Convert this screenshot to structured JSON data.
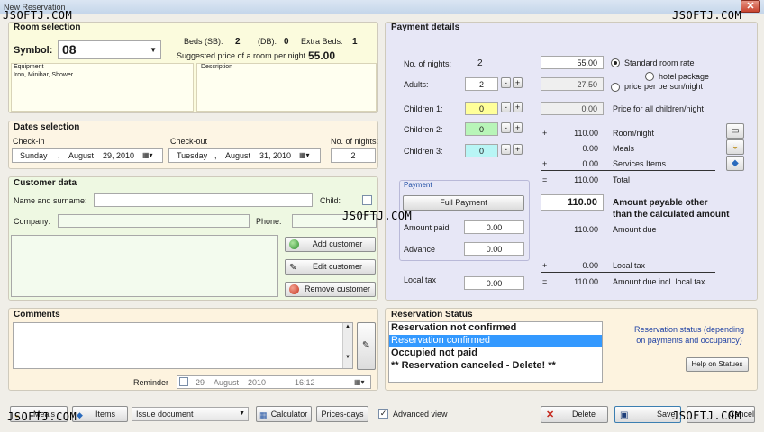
{
  "window": {
    "title": "New Reservation"
  },
  "watermarks": {
    "top_left": "JSOFTJ.COM",
    "top_right": "JSOFTJ.COM",
    "center": "JSOFTJ.COM",
    "bottom_left": "JSOFTJ.COM",
    "bottom_right": "JSOFTJ.COM"
  },
  "room": {
    "title": "Room selection",
    "symbol_label": "Symbol:",
    "symbol_value": "08",
    "beds_sb_label": "Beds (SB):",
    "beds_sb_value": "2",
    "beds_db_label": "(DB):",
    "beds_db_value": "0",
    "extra_beds_label": "Extra Beds:",
    "extra_beds_value": "1",
    "suggested_label": "Suggested price of a room per night",
    "suggested_value": "55.00",
    "equipment_label": "Equipment",
    "equipment_value": "Iron, Minibar, Shower",
    "description_label": "Description"
  },
  "dates": {
    "title": "Dates selection",
    "checkin_label": "Check-in",
    "checkin": {
      "weekday": "Sunday",
      "sep": ",",
      "month": "August",
      "day_year": "29, 2010"
    },
    "checkout_label": "Check-out",
    "checkout": {
      "weekday": "Tuesday",
      "sep": ",",
      "month": "August",
      "day_year": "31, 2010"
    },
    "nights_label": "No. of nights:",
    "nights_value": "2"
  },
  "customer": {
    "title": "Customer data",
    "name_label": "Name and surname:",
    "child_label": "Child:",
    "company_label": "Company:",
    "phone_label": "Phone:",
    "add_label": "Add customer",
    "edit_label": "Edit customer",
    "remove_label": "Remove customer"
  },
  "payment": {
    "title": "Payment details",
    "nights_label": "No. of nights:",
    "nights_value": "2",
    "adults_label": "Adults:",
    "adults_value": "2",
    "children1_label": "Children 1:",
    "children1_value": "0",
    "children2_label": "Children 2:",
    "children2_value": "0",
    "children3_label": "Children 3:",
    "children3_value": "0",
    "rate_value": "55.00",
    "per_person_value": "27.50",
    "children_value": "0.00",
    "standard_rate_label": "Standard room rate",
    "hotel_package_label": "hotel package",
    "per_person_label": "price per person/night",
    "children_price_label": "Price for all children/night",
    "room_night_sign": "+",
    "room_night_value": "110.00",
    "room_night_label": "Room/night",
    "meals_value": "0.00",
    "meals_label": "Meals",
    "services_sign": "+",
    "services_value": "0.00",
    "services_label": "Services Items",
    "total_sign": "=",
    "total_value": "110.00",
    "total_label": "Total",
    "payable_value": "110.00",
    "payable_label_1": "Amount payable other",
    "payable_label_2": "than the calculated amount",
    "amount_due_value": "110.00",
    "amount_due_label": "Amount due",
    "local_tax_sign": "+",
    "local_tax_value": "0.00",
    "local_tax_right_label": "Local tax",
    "due_incl_sign": "=",
    "due_incl_value": "110.00",
    "due_incl_label": "Amount due incl. local tax",
    "sub_title": "Payment",
    "full_payment_label": "Full Payment",
    "amount_paid_label": "Amount paid",
    "amount_paid_value": "0.00",
    "advance_label": "Advance",
    "advance_value": "0.00",
    "local_tax_label": "Local tax",
    "local_tax_field_value": "0.00"
  },
  "comments": {
    "title": "Comments",
    "reminder_label": "Reminder",
    "reminder_day": "29",
    "reminder_month": "August",
    "reminder_year": "2010",
    "reminder_time": "16:12"
  },
  "status": {
    "title": "Reservation Status",
    "items": [
      "Reservation not confirmed",
      "Reservation confirmed",
      "Occupied not paid",
      "** Reservation canceled - Delete! **"
    ],
    "selected_index": 1,
    "note": "Reservation status (depending on payments and occupancy)",
    "help_label": "Help on Statues"
  },
  "toolbar": {
    "meals_label": "Meals",
    "items_label": "Items",
    "issue_label": "Issue document",
    "calculator_label": "Calculator",
    "prices_label": "Prices-days",
    "advanced_label": "Advanced view",
    "advanced_checked": true,
    "delete_label": "Delete",
    "save_label": "Save",
    "cancel_label": "Cancel"
  },
  "colors": {
    "room_bg": "#fbfbdd",
    "dates_bg": "#fdf5e4",
    "customer_bg": "#eef8e2",
    "comments_bg": "#fdf3df",
    "payment_bg": "#e7e7f6",
    "status_bg": "#fdf3df",
    "child1": "#ffff99",
    "child2": "#b8f5b8",
    "child3": "#b8f5f5"
  }
}
